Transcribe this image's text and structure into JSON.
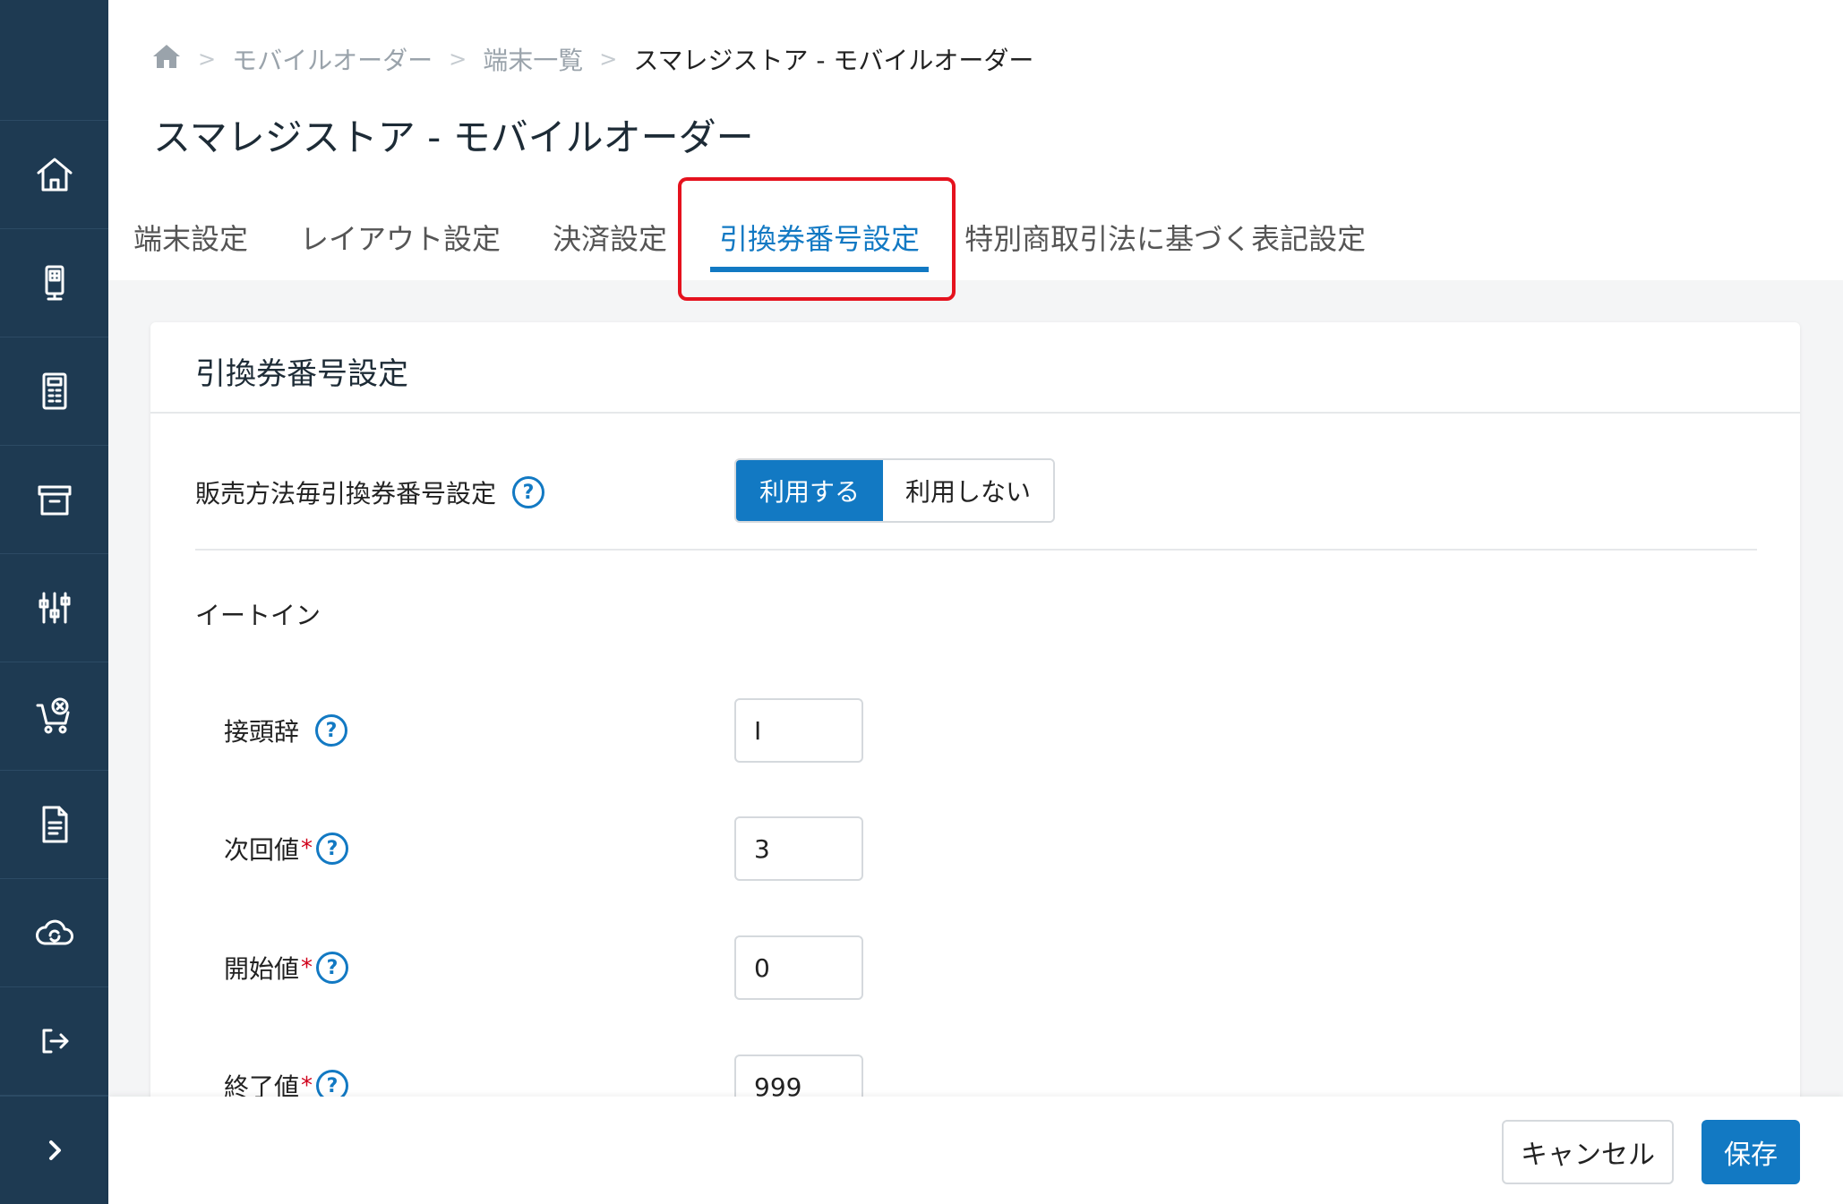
{
  "breadcrumb": {
    "items": [
      "モバイルオーダー",
      "端末一覧",
      "スマレジストア - モバイルオーダー"
    ],
    "separator": ">"
  },
  "page": {
    "title": "スマレジストア - モバイルオーダー"
  },
  "tabs": [
    {
      "label": "端末設定",
      "active": false
    },
    {
      "label": "レイアウト設定",
      "active": false
    },
    {
      "label": "決済設定",
      "active": false
    },
    {
      "label": "引換券番号設定",
      "active": true
    },
    {
      "label": "特別商取引法に基づく表記設定",
      "active": false
    }
  ],
  "card": {
    "title": "引換券番号設定",
    "per_sales_method": {
      "label": "販売方法毎引換券番号設定",
      "options": [
        "利用する",
        "利用しない"
      ],
      "selected": "利用する"
    },
    "section_label": "イートイン",
    "fields": [
      {
        "label": "接頭辞",
        "required": false,
        "value": "I"
      },
      {
        "label": "次回値",
        "required": true,
        "value": "3"
      },
      {
        "label": "開始値",
        "required": true,
        "value": "0"
      },
      {
        "label": "終了値",
        "required": true,
        "value": "999"
      }
    ],
    "help_glyph": "?",
    "required_mark": "*"
  },
  "footer": {
    "cancel_label": "キャンセル",
    "save_label": "保存"
  },
  "colors": {
    "sidebar": "#1e3a52",
    "accent": "#1279c3",
    "highlight": "#e5121e",
    "required": "#d0021b"
  },
  "icons": {
    "sidebar": [
      "home-icon",
      "tablet-icon",
      "calculator-icon",
      "archive-icon",
      "sliders-icon",
      "cart-cancel-icon",
      "document-icon",
      "cloud-sync-icon",
      "logout-icon"
    ],
    "expand": "chevron-right-icon"
  }
}
